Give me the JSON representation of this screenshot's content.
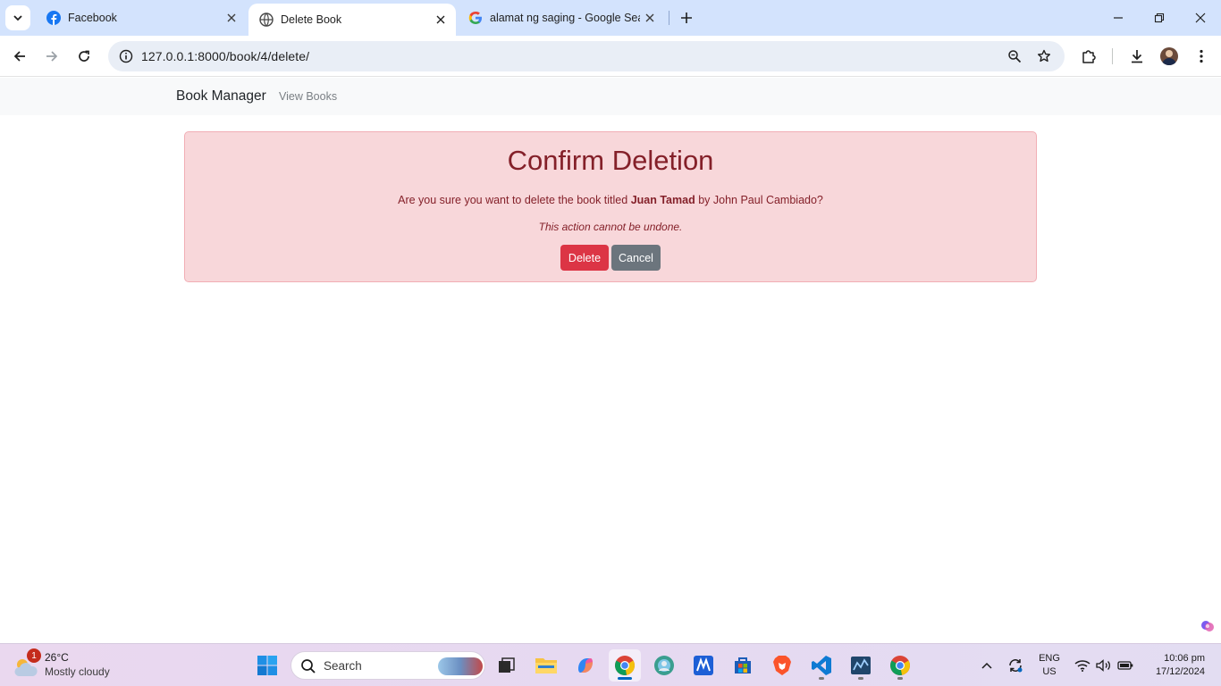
{
  "browser": {
    "tabs": [
      {
        "title": "Facebook",
        "icon": "facebook-icon",
        "active": false
      },
      {
        "title": "Delete Book",
        "icon": "globe-icon",
        "active": true
      },
      {
        "title": "alamat ng saging - Google Search",
        "icon": "google-icon",
        "active": false
      }
    ],
    "url": "127.0.0.1:8000/book/4/delete/"
  },
  "navbar": {
    "brand": "Book Manager",
    "link": "View Books"
  },
  "dialog": {
    "title": "Confirm Deletion",
    "question_prefix": "Are you sure you want to delete the book titled",
    "book_title": "Juan Tamad",
    "question_suffix": "by John Paul Cambiado?",
    "warning": "This action cannot be undone.",
    "delete_label": "Delete",
    "cancel_label": "Cancel"
  },
  "taskbar": {
    "weather_temp": "26°C",
    "weather_condition": "Mostly cloudy",
    "weather_badge": "1",
    "search_label": "Search",
    "language_line1": "ENG",
    "language_line2": "US",
    "time": "10:06 pm",
    "date": "17/12/2024"
  },
  "colors": {
    "tabstrip": "#d3e3fd",
    "alert_bg": "#f8d7da",
    "alert_text": "#842029",
    "danger": "#dc3545",
    "secondary": "#6c757d"
  }
}
